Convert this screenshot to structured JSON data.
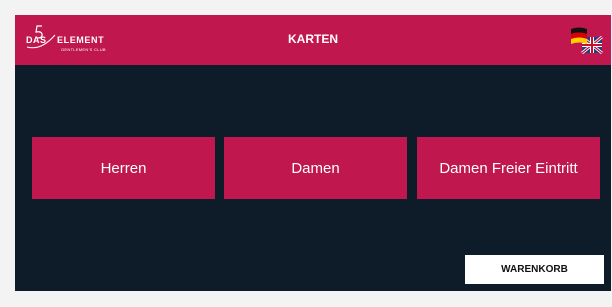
{
  "header": {
    "title": "KARTEN"
  },
  "logo": {
    "mark": "5",
    "prefix": "DAS",
    "name": "ELEMENT",
    "tagline": "GENTLEMEN'S CLUB"
  },
  "language_selector": {
    "icon": "flag-de-uk-icon"
  },
  "cards": [
    {
      "label": "Herren"
    },
    {
      "label": "Damen"
    },
    {
      "label": "Damen Freier Eintritt"
    }
  ],
  "cart": {
    "label": "WARENKORB"
  },
  "colors": {
    "accent": "#c0174f",
    "background": "#0e1c29",
    "button_bg": "#ffffff"
  }
}
